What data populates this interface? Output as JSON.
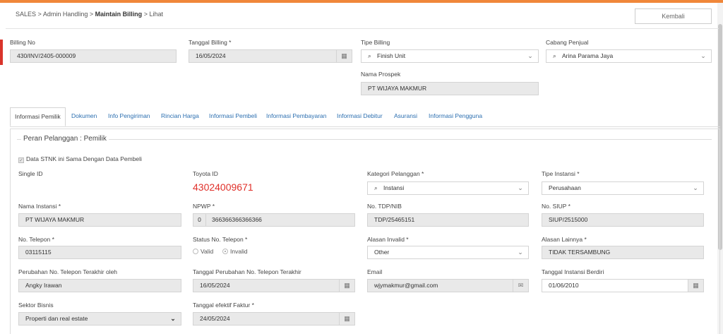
{
  "breadcrumb": {
    "items": [
      "SALES",
      "Admin Handling",
      "Maintain Billing",
      "Lihat"
    ],
    "separator": ">"
  },
  "back_button": "Kembali",
  "header_fields": {
    "billing_no": {
      "label": "Billing No",
      "value": "430/INV/2405-000009"
    },
    "tanggal_billing": {
      "label": "Tanggal Billing *",
      "value": "16/05/2024"
    },
    "tipe_billing": {
      "label": "Tipe Billing",
      "value": "Finish Unit"
    },
    "cabang_penjual": {
      "label": "Cabang Penjual",
      "value": "Arina Parama Jaya"
    },
    "nama_prospek": {
      "label": "Nama Prospek",
      "value": "PT WIJAYA MAKMUR"
    }
  },
  "tabs": [
    {
      "label": "Informasi Pemilik",
      "active": true
    },
    {
      "label": "Dokumen"
    },
    {
      "label": "Info Pengiriman"
    },
    {
      "label": "Rincian Harga"
    },
    {
      "label": "Informasi Pembeli"
    },
    {
      "label": "Informasi Pembayaran"
    },
    {
      "label": "Informasi Debitur"
    },
    {
      "label": "Asuransi"
    },
    {
      "label": "Informasi Pengguna"
    }
  ],
  "section": {
    "title": "Peran Pelanggan : Pemilik",
    "same_as_buyer": {
      "label": "Data STNK ini Sama Dengan Data Pembeli",
      "checked": true
    },
    "single_id": {
      "label": "Single ID",
      "value": ""
    },
    "toyota_id": {
      "label": "Toyota ID",
      "value": "43024009671"
    },
    "kategori_pelanggan": {
      "label": "Kategori Pelanggan *",
      "value": "Instansi"
    },
    "tipe_instansi": {
      "label": "Tipe Instansi *",
      "value": "Perusahaan"
    },
    "nama_instansi": {
      "label": "Nama Instansi *",
      "value": "PT WIJAYA MAKMUR"
    },
    "npwp": {
      "label": "NPWP *",
      "prefix": "0",
      "value": "366366366366366"
    },
    "no_tdp": {
      "label": "No. TDP/NIB",
      "value": "TDP/25465151"
    },
    "no_siup": {
      "label": "No. SIUP *",
      "value": "SIUP/2515000"
    },
    "no_telepon": {
      "label": "No. Telepon *",
      "value": "03115115"
    },
    "status_telepon": {
      "label": "Status No. Telepon *",
      "options": [
        "Valid",
        "Invalid"
      ],
      "selected": "Invalid"
    },
    "alasan_invalid": {
      "label": "Alasan Invalid *",
      "value": "Other"
    },
    "alasan_lainnya": {
      "label": "Alasan Lainnya *",
      "value": "TIDAK TERSAMBUNG"
    },
    "perubahan_oleh": {
      "label": "Perubahan No. Telepon Terakhir oleh",
      "value": "Angky Irawan"
    },
    "tanggal_perubahan": {
      "label": "Tanggal Perubahan No. Telepon Terakhir",
      "value": "16/05/2024"
    },
    "email": {
      "label": "Email",
      "value": "wjymakmur@gmail.com"
    },
    "tanggal_instansi": {
      "label": "Tanggal Instansi Berdiri",
      "value": "01/06/2010"
    },
    "sektor_bisnis": {
      "label": "Sektor Bisnis",
      "value": "Properti dan real estate"
    },
    "tanggal_efektif": {
      "label": "Tanggal efektif Faktur *",
      "value": "24/05/2024"
    }
  },
  "colors": {
    "accent": "#f0873a",
    "link": "#2c6fb0",
    "toyota_id": "#e0302a"
  },
  "icons": [
    "calendar-icon",
    "chevron-down-icon",
    "search-icon",
    "email-icon",
    "check-icon"
  ]
}
